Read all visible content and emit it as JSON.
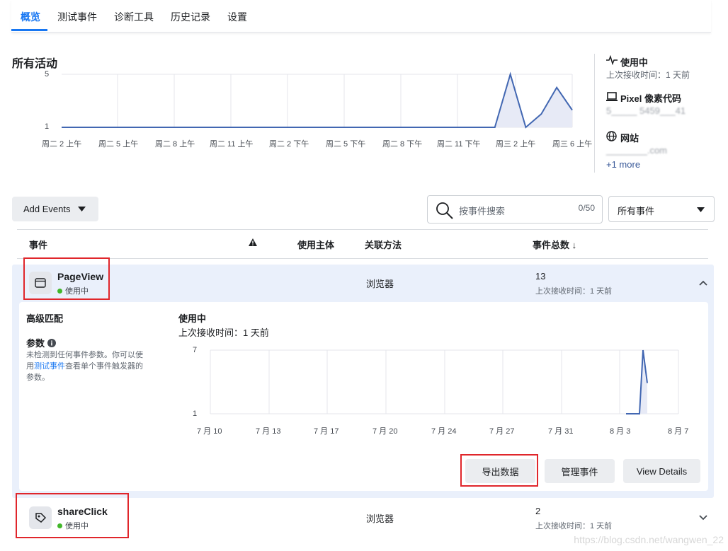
{
  "tabs": [
    "概览",
    "测试事件",
    "诊断工具",
    "历史记录",
    "设置"
  ],
  "overview": {
    "title": "所有活动",
    "chart_data": {
      "type": "area",
      "x": [
        "周二 2 上午",
        "周二 5 上午",
        "周二 8 上午",
        "周二 11 上午",
        "周二 2 下午",
        "周二 5 下午",
        "周二 8 下午",
        "周二 11 下午",
        "周三 2 上午",
        "周三 6 上午"
      ],
      "y_ticks": [
        "5",
        "1"
      ],
      "series": [
        {
          "values": [
            1,
            1,
            1,
            1,
            1,
            1,
            1,
            1,
            1,
            1,
            1,
            1,
            1,
            1,
            1,
            1,
            1,
            1,
            1,
            1,
            1,
            1,
            1,
            1,
            1,
            1,
            1,
            1,
            1,
            5,
            1,
            2,
            4,
            2.3
          ]
        }
      ],
      "ylim": [
        1,
        5
      ],
      "color": "#4267b2",
      "fill": "#e7eaf6",
      "grid": true
    }
  },
  "side": {
    "status_title": "使用中",
    "status_sub": "上次接收时间：1 天前",
    "pixel_title": "Pixel 像素代码",
    "pixel_id": "5_____ 5459___41",
    "site_title": "网站",
    "site_url": "________.com",
    "more": "+1 more"
  },
  "toolbar": {
    "add_events": "Add Events",
    "search_placeholder": "按事件搜索",
    "search_count": "0/50",
    "filter_value": "所有事件"
  },
  "table": {
    "headers": {
      "event": "事件",
      "subject": "使用主体",
      "method": "关联方法",
      "total": "事件总数 ↓"
    },
    "rows": [
      {
        "name": "PageView",
        "status": "使用中",
        "method": "浏览器",
        "total": "13",
        "last": "上次接收时间：1 天前"
      },
      {
        "name": "shareClick",
        "status": "使用中",
        "method": "浏览器",
        "total": "2",
        "last": "上次接收时间：1 天前"
      }
    ]
  },
  "detail": {
    "advanced_matching": "高级匹配",
    "params_title": "参数",
    "params_desc_1": "未检测到任何事件参数。你可以使",
    "params_desc_2a": "用",
    "params_link": "测试事件",
    "params_desc_2b": "查看单个事件触发器的",
    "params_desc_3": "参数。",
    "status": "使用中",
    "last": "上次接收时间：1 天前",
    "chart_data": {
      "type": "area",
      "x": [
        "7 月 10",
        "7 月 13",
        "7 月 17",
        "7 月 20",
        "7 月 24",
        "7 月 27",
        "7 月 31",
        "8 月 3",
        "8 月 7"
      ],
      "y_ticks": [
        "7",
        "1"
      ],
      "series": [
        {
          "points": [
            [
              "8 月 3",
              1
            ],
            [
              "8 月 4",
              1
            ],
            [
              "8 月 5",
              7
            ],
            [
              "8 月 5 (later)",
              3.9
            ]
          ]
        }
      ],
      "ylim": [
        1,
        7
      ],
      "color": "#4267b2"
    },
    "buttons": {
      "export": "导出数据",
      "manage": "管理事件",
      "view": "View Details"
    }
  },
  "watermark": "https://blog.csdn.net/wangwen_22"
}
